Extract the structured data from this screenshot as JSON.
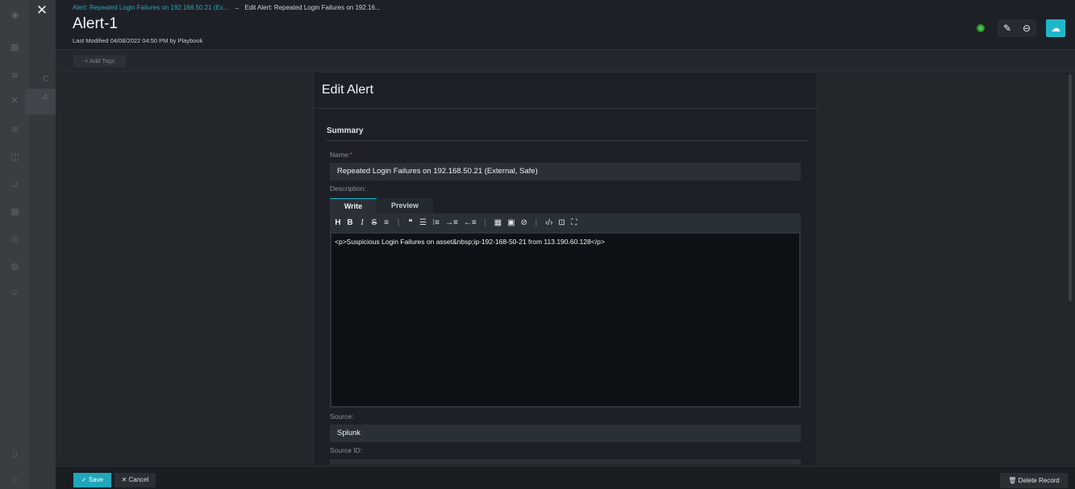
{
  "window": {
    "close_glyph": "✕"
  },
  "breadcrumb": {
    "parent": "Alert: Repeated Login Failures on 192.168.50.21 (Ex...",
    "arrow": "→",
    "current": "Edit Alert: Repeated Login Failures on 192.16..."
  },
  "header": {
    "title": "Alert-1",
    "last_modified": "Last Modified 04/08/2022 04:50 PM by Playbook",
    "status_color": "#48c248",
    "edit_icon": "✎",
    "link_icon": "⊖",
    "chat_icon": "☁"
  },
  "tags": {
    "add_label": "+ Add Tags"
  },
  "sidebar_ghost": {
    "letter1": "C",
    "letter2": "A"
  },
  "panel": {
    "title": "Edit Alert",
    "section": "Summary",
    "name_label": "Name:",
    "name_required": "*",
    "name_value": "Repeated Login Failures on 192.168.50.21 (External, Safe)",
    "description_label": "Description:",
    "tabs": {
      "write": "Write",
      "preview": "Preview"
    },
    "toolbar": {
      "heading": "H",
      "bold": "B",
      "italic": "I",
      "strike": "S",
      "hr": "≡",
      "sep": "|",
      "quote": "❝",
      "ul": "☰",
      "ol": "⁝≡",
      "indent": "→≡",
      "outdent": "←≡",
      "table": "▦",
      "image": "▣",
      "link": "⊘",
      "code": "‹/›",
      "preview": "⊡",
      "fullscreen": "⛶"
    },
    "description_value": "<p>Suspicious Login Failures on asset&nbsp;ip-192-168-50-21 from 113.190.60.128</p>",
    "source_label": "Source:",
    "source_value": "Splunk",
    "source_id_label": "Source ID:"
  },
  "footer": {
    "save": "✓  Save",
    "cancel": "✕  Cancel",
    "delete": "🗑 Delete Record"
  },
  "colors": {
    "accent": "#1fb6c9",
    "save": "#1fa7bb",
    "link": "#2aa6b5"
  }
}
